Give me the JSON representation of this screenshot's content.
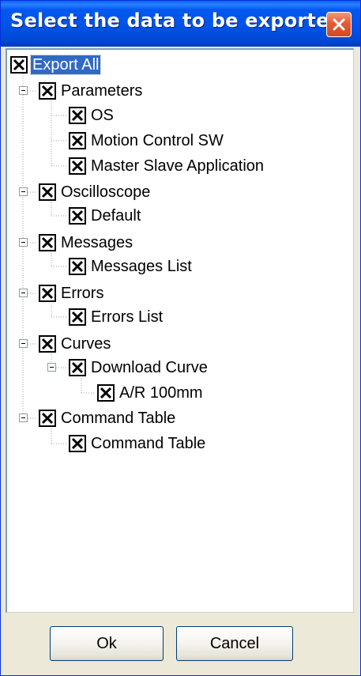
{
  "window": {
    "title": "Select the data to be exported."
  },
  "tree": {
    "root": {
      "label": "Export All",
      "checked": true,
      "selected": true
    },
    "groups": [
      {
        "label": "Parameters",
        "checked": true,
        "expanded": true,
        "children": [
          {
            "label": "OS",
            "checked": true
          },
          {
            "label": "Motion Control SW",
            "checked": true
          },
          {
            "label": "Master Slave Application",
            "checked": true
          }
        ]
      },
      {
        "label": "Oscilloscope",
        "checked": true,
        "expanded": true,
        "children": [
          {
            "label": "Default",
            "checked": true
          }
        ]
      },
      {
        "label": "Messages",
        "checked": true,
        "expanded": true,
        "children": [
          {
            "label": "Messages List",
            "checked": true
          }
        ]
      },
      {
        "label": "Errors",
        "checked": true,
        "expanded": true,
        "children": [
          {
            "label": "Errors List",
            "checked": true
          }
        ]
      },
      {
        "label": "Curves",
        "checked": true,
        "expanded": true,
        "children": [
          {
            "label": "Download Curve",
            "checked": true,
            "expanded": true,
            "children": [
              {
                "label": "A/R 100mm",
                "checked": true
              }
            ]
          }
        ]
      },
      {
        "label": "Command Table",
        "checked": true,
        "expanded": true,
        "children": [
          {
            "label": "Command Table",
            "checked": true
          }
        ]
      }
    ]
  },
  "buttons": {
    "ok_label": "Ok",
    "cancel_label": "Cancel"
  },
  "icons": {
    "checkbox": "checked-x-icon",
    "expander": "minus-collapse-icon",
    "close": "close-x-icon"
  },
  "colors": {
    "titlebar": "#0053e6",
    "selection": "#316ac5",
    "close_button": "#e45a35"
  }
}
